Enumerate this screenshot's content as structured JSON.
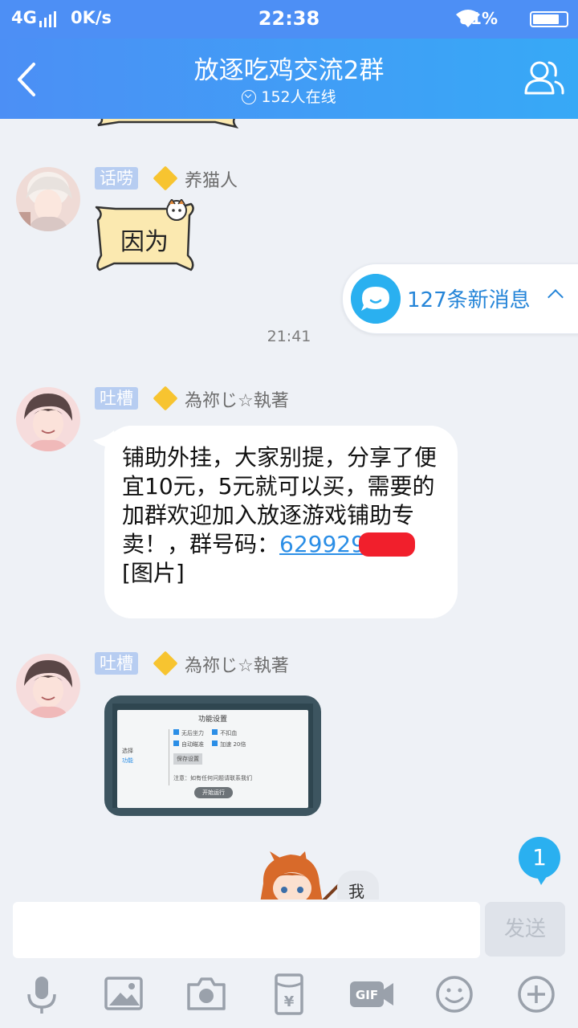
{
  "status_bar": {
    "network": "4G",
    "speed": "0K/s",
    "time": "22:38",
    "battery": "81%",
    "battery_level": 0.81
  },
  "header": {
    "title": "放逐吃鸡交流2群",
    "online": "152人在线"
  },
  "new_messages": {
    "label": "127条新消息"
  },
  "messages": [
    {
      "role": "话唠",
      "nickname": "养猫人",
      "sticker_text": "因为"
    },
    {
      "type": "time",
      "text": "21:41"
    },
    {
      "role": "吐槽",
      "nickname": "為祢じ☆執著",
      "text_before": "铺助外挂，大家别提，分享了便宜10元，5元就可以买，需要的加群欢迎加入放逐游戏铺助专卖！，群号码：",
      "number": "629929",
      "text_after": "[图片]"
    },
    {
      "role": "吐槽",
      "nickname": "為祢じ☆執著",
      "image": {
        "title": "功能设置",
        "side_label": "选择",
        "side_link": "功能",
        "options": [
          "无后坐力",
          "不扣血",
          "自动瞄准",
          "加速",
          "20倍"
        ],
        "button": "保存设置",
        "note": "注意：如有任何问题请联系我们",
        "start_button": "开始运行"
      }
    },
    {
      "partial_text": "我"
    }
  ],
  "unread_count": "1",
  "input": {
    "placeholder": "",
    "send_label": "发送"
  },
  "toolbar": [
    "mic-icon",
    "image-icon",
    "camera-icon",
    "red-packet-icon",
    "gif-icon",
    "emoji-icon",
    "plus-icon"
  ]
}
